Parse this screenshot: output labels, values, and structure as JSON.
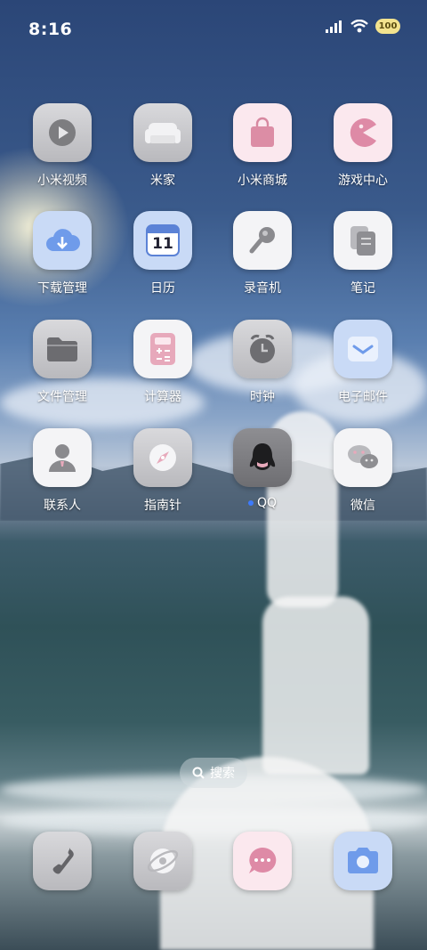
{
  "status_bar": {
    "time": "8:16",
    "battery": "100"
  },
  "home": {
    "apps": [
      {
        "label": "小米视频",
        "icon": "play-icon"
      },
      {
        "label": "米家",
        "icon": "sofa-icon"
      },
      {
        "label": "小米商城",
        "icon": "shopping-bag-icon"
      },
      {
        "label": "游戏中心",
        "icon": "game-pacman-icon"
      },
      {
        "label": "下载管理",
        "icon": "cloud-download-icon"
      },
      {
        "label": "日历",
        "icon": "calendar-icon",
        "date": "11"
      },
      {
        "label": "录音机",
        "icon": "microphone-icon"
      },
      {
        "label": "笔记",
        "icon": "notes-icon"
      },
      {
        "label": "文件管理",
        "icon": "folder-icon"
      },
      {
        "label": "计算器",
        "icon": "calculator-icon"
      },
      {
        "label": "时钟",
        "icon": "alarm-clock-icon"
      },
      {
        "label": "电子邮件",
        "icon": "envelope-icon"
      },
      {
        "label": "联系人",
        "icon": "contact-person-icon"
      },
      {
        "label": "指南针",
        "icon": "compass-icon"
      },
      {
        "label": "QQ",
        "icon": "qq-penguin-icon",
        "update_dot": true
      },
      {
        "label": "微信",
        "icon": "wechat-icon"
      }
    ],
    "search_label": "搜索"
  },
  "dock": [
    {
      "icon": "phone-icon"
    },
    {
      "icon": "browser-icon"
    },
    {
      "icon": "message-icon"
    },
    {
      "icon": "camera-icon"
    }
  ]
}
